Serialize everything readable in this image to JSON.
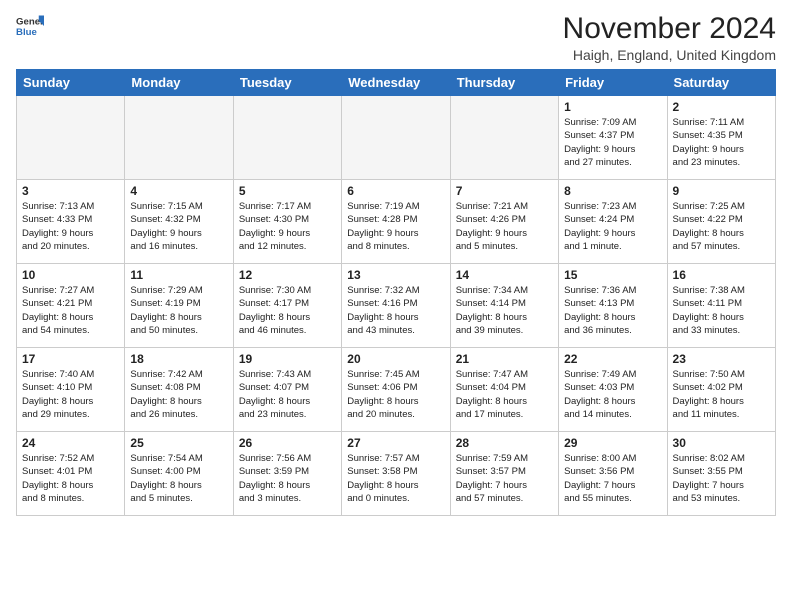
{
  "logo": {
    "general": "General",
    "blue": "Blue"
  },
  "header": {
    "month": "November 2024",
    "location": "Haigh, England, United Kingdom"
  },
  "weekdays": [
    "Sunday",
    "Monday",
    "Tuesday",
    "Wednesday",
    "Thursday",
    "Friday",
    "Saturday"
  ],
  "weeks": [
    [
      {
        "day": "",
        "info": ""
      },
      {
        "day": "",
        "info": ""
      },
      {
        "day": "",
        "info": ""
      },
      {
        "day": "",
        "info": ""
      },
      {
        "day": "",
        "info": ""
      },
      {
        "day": "1",
        "info": "Sunrise: 7:09 AM\nSunset: 4:37 PM\nDaylight: 9 hours\nand 27 minutes."
      },
      {
        "day": "2",
        "info": "Sunrise: 7:11 AM\nSunset: 4:35 PM\nDaylight: 9 hours\nand 23 minutes."
      }
    ],
    [
      {
        "day": "3",
        "info": "Sunrise: 7:13 AM\nSunset: 4:33 PM\nDaylight: 9 hours\nand 20 minutes."
      },
      {
        "day": "4",
        "info": "Sunrise: 7:15 AM\nSunset: 4:32 PM\nDaylight: 9 hours\nand 16 minutes."
      },
      {
        "day": "5",
        "info": "Sunrise: 7:17 AM\nSunset: 4:30 PM\nDaylight: 9 hours\nand 12 minutes."
      },
      {
        "day": "6",
        "info": "Sunrise: 7:19 AM\nSunset: 4:28 PM\nDaylight: 9 hours\nand 8 minutes."
      },
      {
        "day": "7",
        "info": "Sunrise: 7:21 AM\nSunset: 4:26 PM\nDaylight: 9 hours\nand 5 minutes."
      },
      {
        "day": "8",
        "info": "Sunrise: 7:23 AM\nSunset: 4:24 PM\nDaylight: 9 hours\nand 1 minute."
      },
      {
        "day": "9",
        "info": "Sunrise: 7:25 AM\nSunset: 4:22 PM\nDaylight: 8 hours\nand 57 minutes."
      }
    ],
    [
      {
        "day": "10",
        "info": "Sunrise: 7:27 AM\nSunset: 4:21 PM\nDaylight: 8 hours\nand 54 minutes."
      },
      {
        "day": "11",
        "info": "Sunrise: 7:29 AM\nSunset: 4:19 PM\nDaylight: 8 hours\nand 50 minutes."
      },
      {
        "day": "12",
        "info": "Sunrise: 7:30 AM\nSunset: 4:17 PM\nDaylight: 8 hours\nand 46 minutes."
      },
      {
        "day": "13",
        "info": "Sunrise: 7:32 AM\nSunset: 4:16 PM\nDaylight: 8 hours\nand 43 minutes."
      },
      {
        "day": "14",
        "info": "Sunrise: 7:34 AM\nSunset: 4:14 PM\nDaylight: 8 hours\nand 39 minutes."
      },
      {
        "day": "15",
        "info": "Sunrise: 7:36 AM\nSunset: 4:13 PM\nDaylight: 8 hours\nand 36 minutes."
      },
      {
        "day": "16",
        "info": "Sunrise: 7:38 AM\nSunset: 4:11 PM\nDaylight: 8 hours\nand 33 minutes."
      }
    ],
    [
      {
        "day": "17",
        "info": "Sunrise: 7:40 AM\nSunset: 4:10 PM\nDaylight: 8 hours\nand 29 minutes."
      },
      {
        "day": "18",
        "info": "Sunrise: 7:42 AM\nSunset: 4:08 PM\nDaylight: 8 hours\nand 26 minutes."
      },
      {
        "day": "19",
        "info": "Sunrise: 7:43 AM\nSunset: 4:07 PM\nDaylight: 8 hours\nand 23 minutes."
      },
      {
        "day": "20",
        "info": "Sunrise: 7:45 AM\nSunset: 4:06 PM\nDaylight: 8 hours\nand 20 minutes."
      },
      {
        "day": "21",
        "info": "Sunrise: 7:47 AM\nSunset: 4:04 PM\nDaylight: 8 hours\nand 17 minutes."
      },
      {
        "day": "22",
        "info": "Sunrise: 7:49 AM\nSunset: 4:03 PM\nDaylight: 8 hours\nand 14 minutes."
      },
      {
        "day": "23",
        "info": "Sunrise: 7:50 AM\nSunset: 4:02 PM\nDaylight: 8 hours\nand 11 minutes."
      }
    ],
    [
      {
        "day": "24",
        "info": "Sunrise: 7:52 AM\nSunset: 4:01 PM\nDaylight: 8 hours\nand 8 minutes."
      },
      {
        "day": "25",
        "info": "Sunrise: 7:54 AM\nSunset: 4:00 PM\nDaylight: 8 hours\nand 5 minutes."
      },
      {
        "day": "26",
        "info": "Sunrise: 7:56 AM\nSunset: 3:59 PM\nDaylight: 8 hours\nand 3 minutes."
      },
      {
        "day": "27",
        "info": "Sunrise: 7:57 AM\nSunset: 3:58 PM\nDaylight: 8 hours\nand 0 minutes."
      },
      {
        "day": "28",
        "info": "Sunrise: 7:59 AM\nSunset: 3:57 PM\nDaylight: 7 hours\nand 57 minutes."
      },
      {
        "day": "29",
        "info": "Sunrise: 8:00 AM\nSunset: 3:56 PM\nDaylight: 7 hours\nand 55 minutes."
      },
      {
        "day": "30",
        "info": "Sunrise: 8:02 AM\nSunset: 3:55 PM\nDaylight: 7 hours\nand 53 minutes."
      }
    ]
  ]
}
